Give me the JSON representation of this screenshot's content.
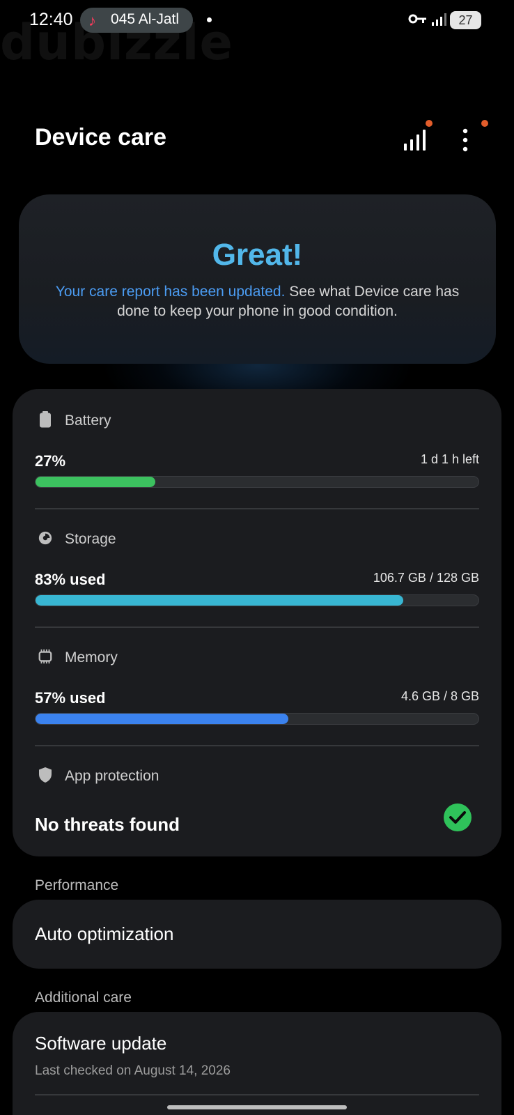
{
  "status_bar": {
    "time": "12:40",
    "media_text": "045 Al-Jatl",
    "battery_level": "27"
  },
  "watermark": "dubizzle",
  "header": {
    "title": "Device care"
  },
  "hero": {
    "title": "Great!",
    "link_text": "Your care report has been updated.",
    "text": " See what Device care has done to keep your phone in good condition."
  },
  "sections": {
    "battery": {
      "label": "Battery",
      "value": "27%",
      "right": "1 d 1 h left",
      "percent": 27,
      "color": "#3cc15f"
    },
    "storage": {
      "label": "Storage",
      "value": "83% used",
      "right": "106.7 GB / 128 GB",
      "percent": 83,
      "color": "#38b6d2"
    },
    "memory": {
      "label": "Memory",
      "value": "57% used",
      "right": "4.6 GB / 8 GB",
      "percent": 57,
      "color": "#3b82ee"
    },
    "protection": {
      "label": "App protection",
      "value": "No threats found"
    }
  },
  "performance": {
    "group_label": "Performance",
    "item": "Auto optimization"
  },
  "additional_care": {
    "group_label": "Additional care",
    "item_title": "Software update",
    "item_sub": "Last checked on August 14, 2026"
  },
  "colors": {
    "accent_blue": "#4b9cf2",
    "badge_orange": "#e35d2b",
    "check_green": "#2fc25a"
  }
}
